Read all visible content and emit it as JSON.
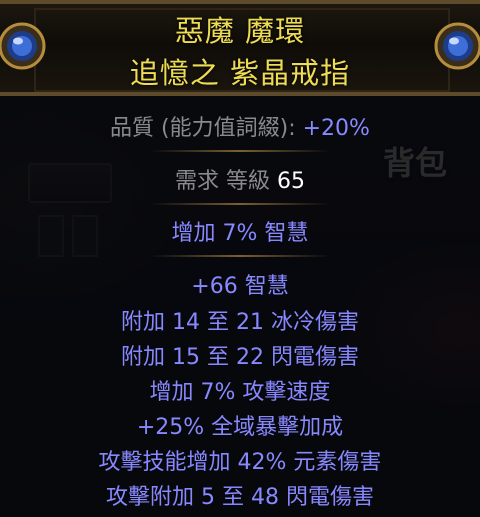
{
  "background": {
    "panel_word": "背包"
  },
  "item": {
    "name": "惡魔 魔環",
    "base_type": "追憶之 紫晶戒指",
    "rarity_color": "#eedc55",
    "properties": {
      "quality_label": "品質 (能力值詞綴):",
      "quality_value": "+20%",
      "requires_label": "需求 等級",
      "requires_value": "65"
    },
    "implicit": "增加 7% 智慧",
    "explicit_mods": [
      "+66 智慧",
      "附加 14 至 21 冰冷傷害",
      "附加 15 至 22 閃電傷害",
      "增加 7% 攻擊速度",
      "+25% 全域暴擊加成",
      "攻擊技能增加 42% 元素傷害",
      "攻擊附加 5 至 48 閃電傷害"
    ],
    "mod_color": "#8888ff"
  }
}
